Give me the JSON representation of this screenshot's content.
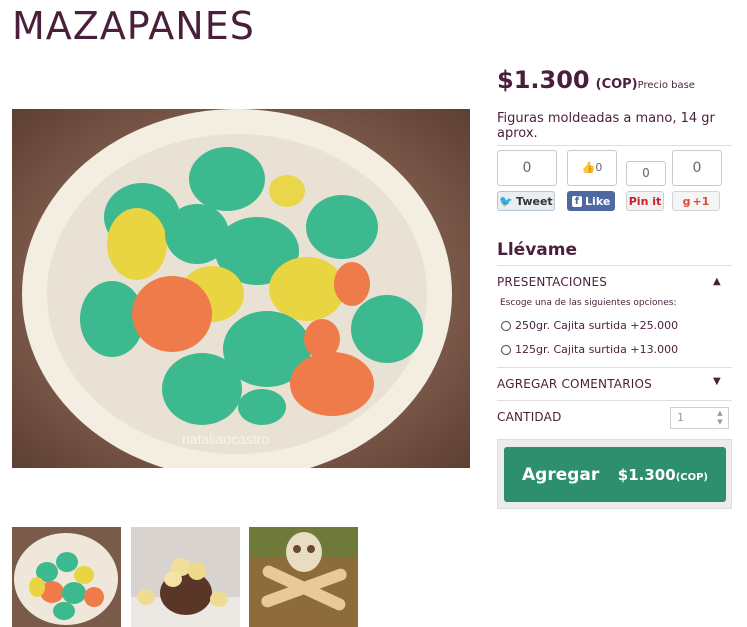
{
  "product": {
    "title": "MAZAPANES",
    "price": "$1.300",
    "currency": "(COP)",
    "price_note": "Precio base",
    "description": "Figuras moldeadas a mano, 14 gr aprox."
  },
  "social": {
    "tweet_count": "0",
    "tweet_label": "Tweet",
    "like_count": "0",
    "like_label": "Like",
    "pinit_count": "0",
    "pinit_label": "Pin it",
    "gplus_count": "0",
    "gplus_label": "+1"
  },
  "purchase": {
    "heading": "Llévame",
    "presentations_label": "PRESENTACIONES",
    "options_hint": "Escoge una de las siguientes opciones:",
    "options": [
      "250gr. Cajita surtida +25.000",
      "125gr. Cajita surtida +13.000"
    ],
    "comments_label": "AGREGAR COMENTARIOS",
    "quantity_label": "CANTIDAD",
    "quantity_value": "1",
    "add_button_label": "Agregar",
    "add_button_price": "$1.300",
    "add_button_currency": "(COP)"
  },
  "colors": {
    "accent": "#2e8f6e",
    "text": "#4a1f3c"
  }
}
